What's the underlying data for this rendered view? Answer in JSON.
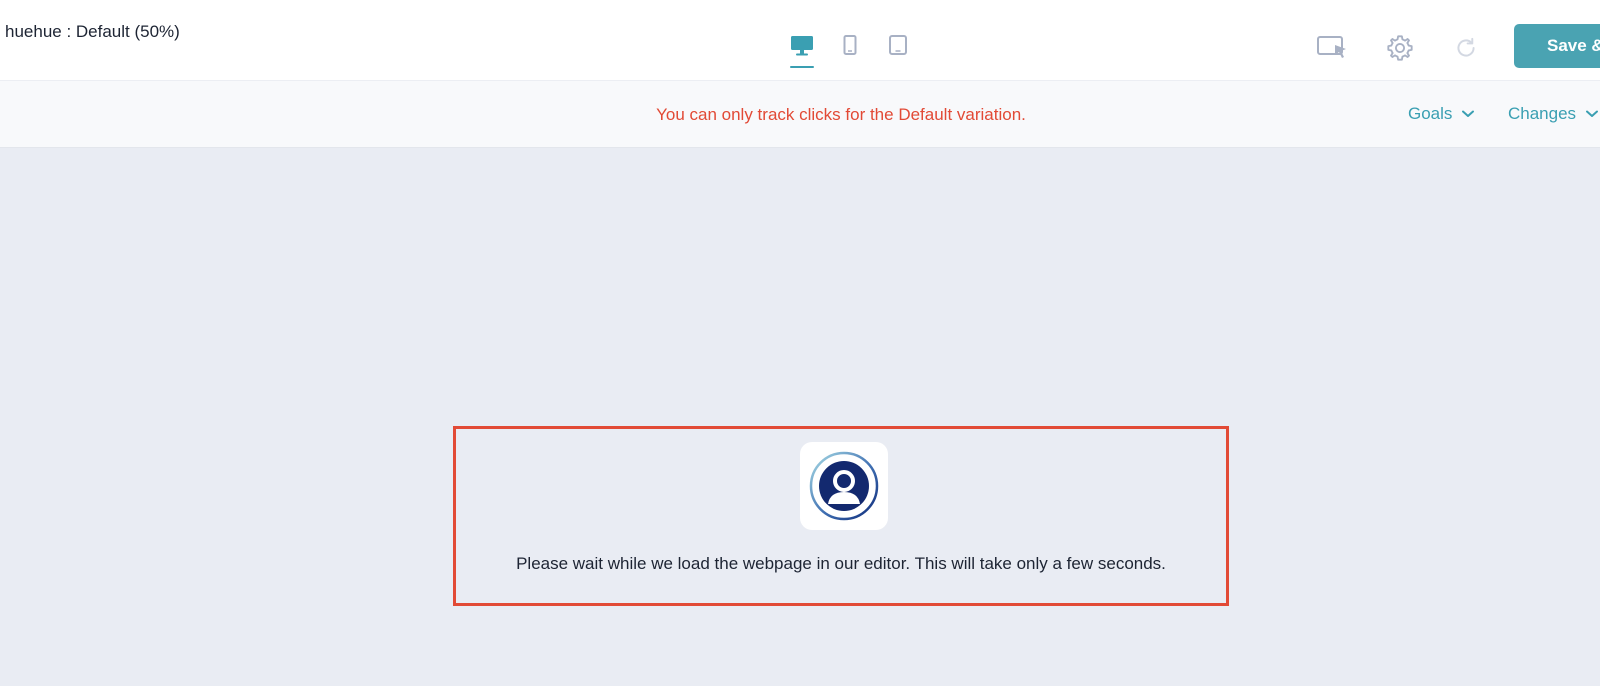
{
  "header": {
    "variation_title": "huehue : Default (50%)",
    "save_label": "Save &",
    "accent_color": "#4aa3b2"
  },
  "devices": [
    {
      "label": "Desktop",
      "icon": "desktop-icon",
      "active": true
    },
    {
      "label": "Tablet",
      "icon": "tablet-portrait-icon",
      "active": false
    },
    {
      "label": "Mobile",
      "icon": "tablet-icon",
      "active": false
    }
  ],
  "tools": [
    {
      "icon": "element-select-icon"
    },
    {
      "icon": "gear-icon"
    },
    {
      "icon": "refresh-icon",
      "disabled": true
    }
  ],
  "subbar": {
    "notice": "You can only track clicks for the Default variation.",
    "notice_color": "#e24a36",
    "goals_label": "Goals",
    "changes_label": "Changes"
  },
  "loader": {
    "message": "Please wait while we load the webpage in our editor. This will take only a few seconds.",
    "logo_icon": "user-avatar-icon"
  }
}
